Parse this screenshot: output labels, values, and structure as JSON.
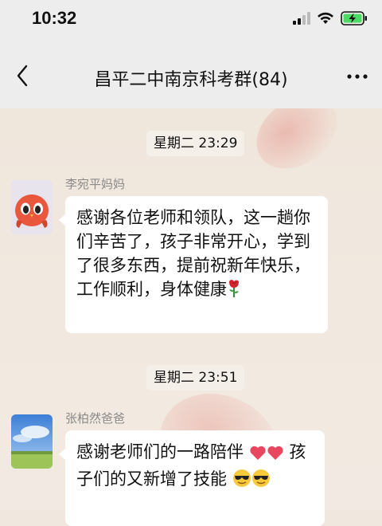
{
  "status_bar": {
    "time": "10:32"
  },
  "header": {
    "title": "昌平二中南京科考群(84)"
  },
  "messages": [
    {
      "timestamp": "星期二 23:29",
      "sender": "李宛平妈妈",
      "text": "感谢各位老师和领队，这一趟你们辛苦了，孩子非常开心，学到了很多东西，提前祝新年快乐，工作顺利，身体健康",
      "lines": [
        "感谢各位老师和领队，这一趟你",
        "们辛苦了，孩子非常开心，学到",
        "了很多东西，提前祝新年快乐，",
        "工作顺利，身体健康"
      ],
      "emoji": [
        "rose-icon"
      ]
    },
    {
      "timestamp": "星期二 23:51",
      "sender": "张柏然爸爸",
      "text": "感谢老师们的一路陪伴 孩子们的又新增了技能",
      "lines": [
        "感谢老师们的一路陪伴",
        "孩",
        "子们的又新增了技能"
      ],
      "emoji": [
        "heart-icon",
        "heart-icon",
        "sunglasses-face-icon",
        "sunglasses-face-icon"
      ]
    }
  ],
  "colors": {
    "nav_background": "#ededed",
    "chat_background": "#f0e7de",
    "bubble": "#ffffff",
    "sender_name": "#8a8a8a",
    "battery_charging": "#4cd964"
  }
}
